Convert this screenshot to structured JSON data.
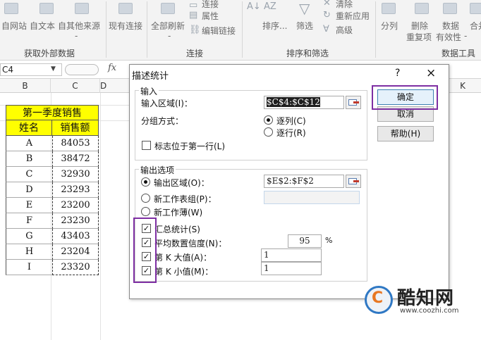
{
  "ribbon": {
    "buttons_large": [
      "自网站",
      "自文本",
      "自其他来源",
      "现有连接",
      "全部刷新",
      "排序...",
      "筛选",
      "分列",
      "删除",
      "数据",
      "合并"
    ],
    "more_arrow": "-",
    "refresh_arrow": "-",
    "row2_labels": [
      "重复项",
      "有效性",
      "-"
    ],
    "small_items": {
      "connections": "连接",
      "properties": "属性",
      "edit_links": "编辑链接",
      "clear": "清除",
      "reapply": "重新应用",
      "advanced": "高级"
    },
    "group_labels": [
      "获取外部数据",
      "连接",
      "排序和筛选",
      "数据工具"
    ]
  },
  "formula_bar": {
    "name_box": "C4",
    "name_box_arrow": "▼",
    "fx": "fx"
  },
  "sheet": {
    "columns": [
      "B",
      "C",
      "D",
      "K"
    ],
    "title": "第一季度销售",
    "headers": [
      "姓名",
      "销售额"
    ],
    "rows": [
      [
        "A",
        "84053"
      ],
      [
        "B",
        "38472"
      ],
      [
        "C",
        "32930"
      ],
      [
        "D",
        "23293"
      ],
      [
        "E",
        "23200"
      ],
      [
        "F",
        "23230"
      ],
      [
        "G",
        "43403"
      ],
      [
        "H",
        "23204"
      ],
      [
        "I",
        "23320"
      ]
    ]
  },
  "dialog": {
    "title": "描述统计",
    "help": "?",
    "close": "×",
    "input_group": "输入",
    "input_range_label": "输入区域(I)：",
    "input_range_value": "$C$4:$C$12",
    "grouped_by_label": "分组方式：",
    "by_columns": "逐列(C)",
    "by_rows": "逐行(R)",
    "labels_first_row": "标志位于第一行(L)",
    "output_group": "输出选项",
    "output_range_label": "输出区域(O)：",
    "output_range_value": "$E$2:$F$2",
    "new_worksheet": "新工作表组(P)：",
    "new_workbook": "新工作薄(W)",
    "summary_stats": "汇总统计(S)",
    "confidence_label": "平均数置信度(N)：",
    "confidence_value": "95",
    "percent": "%",
    "kth_largest_label": "第 K 大值(A)：",
    "kth_largest_value": "1",
    "kth_smallest_label": "第 K 小值(M)：",
    "kth_smallest_value": "1",
    "ok": "确定",
    "cancel": "取消",
    "help_btn": "帮助(H)",
    "check_mark": "✓"
  },
  "watermark": {
    "logo_letter": "C",
    "name": "酷知网",
    "url": "www.coozhi.com"
  },
  "colors": {
    "highlight": "#7e2fa3",
    "yellow": "#ffff00",
    "link_blue": "#2f78c4"
  }
}
